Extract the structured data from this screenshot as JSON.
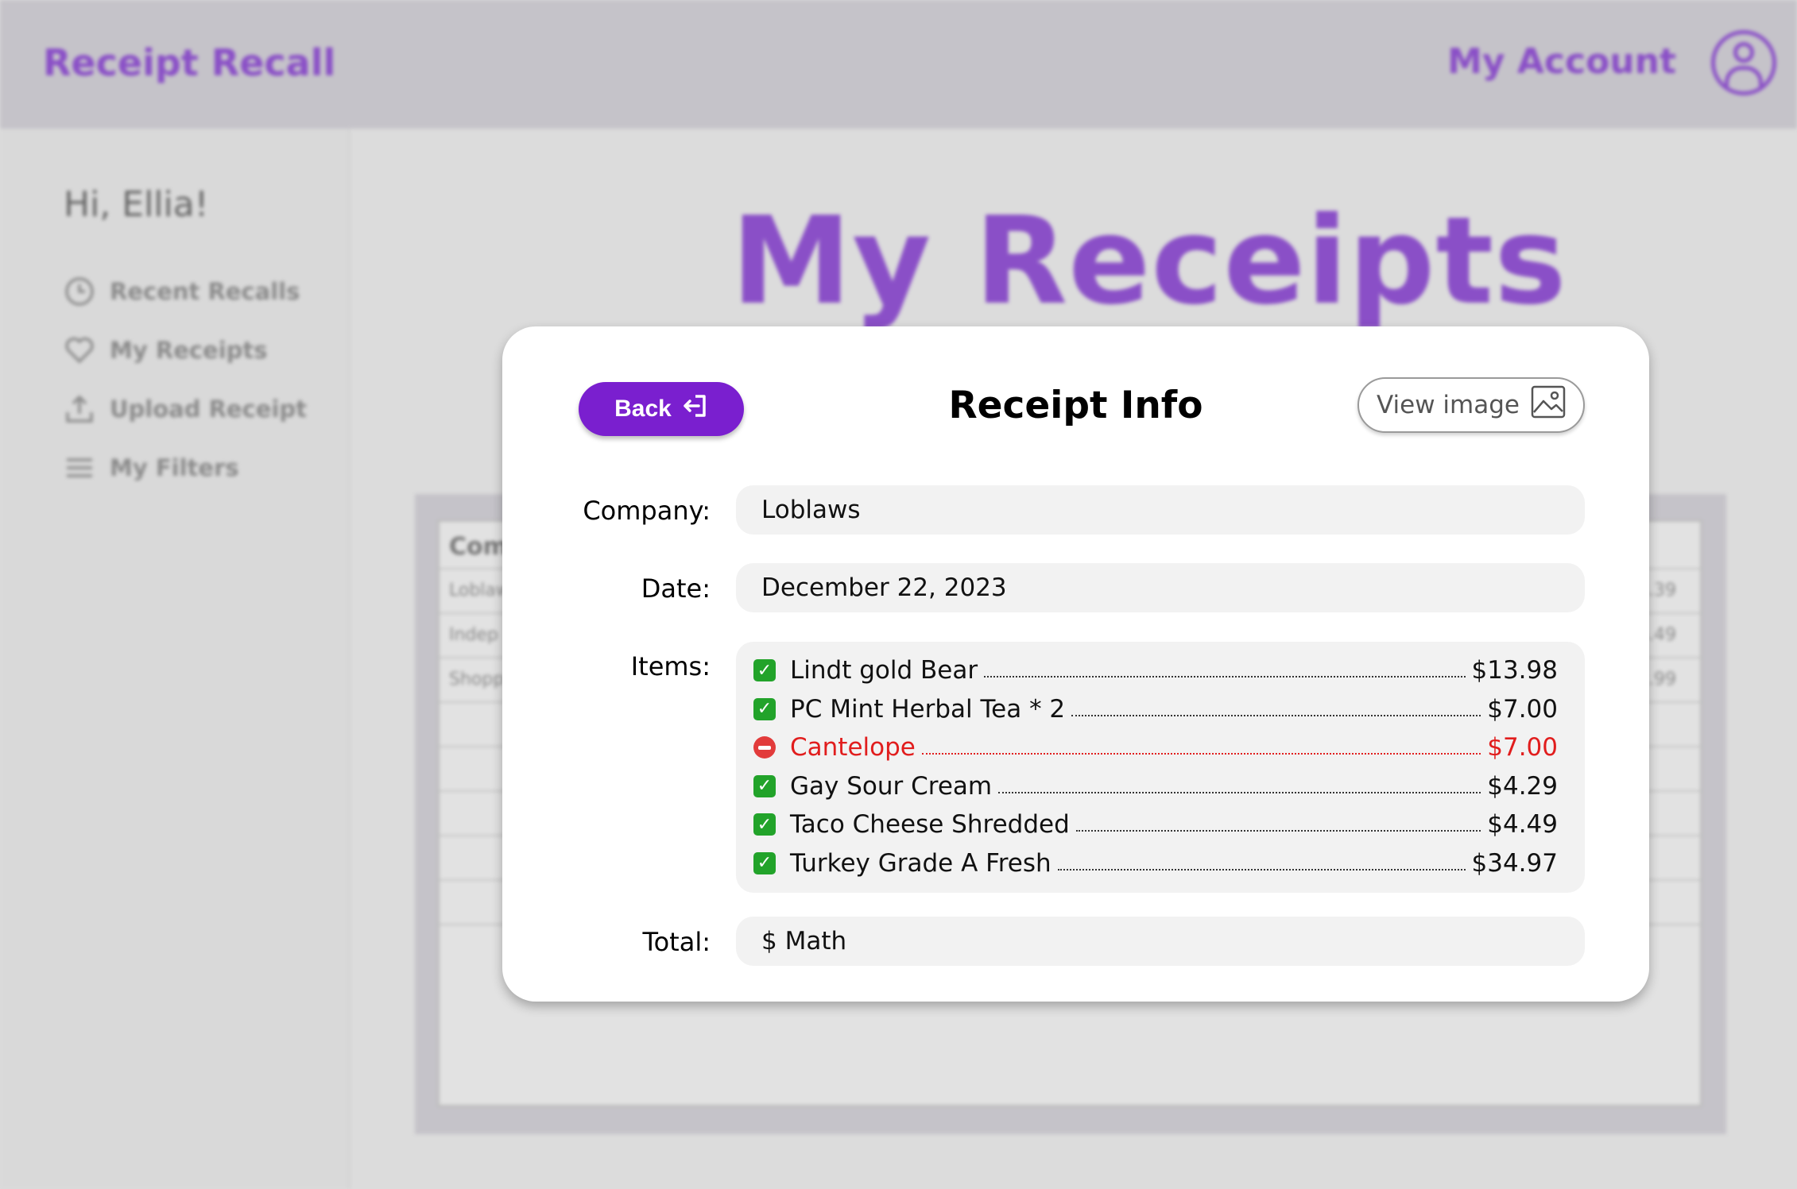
{
  "app": {
    "brand": "Receipt Recall",
    "account_label": "My Account"
  },
  "sidebar": {
    "greeting": "Hi, Ellia!",
    "items": [
      {
        "label": "Recent Recalls",
        "icon": "clock-icon"
      },
      {
        "label": "My Receipts",
        "icon": "heart-icon"
      },
      {
        "label": "Upload Receipt",
        "icon": "upload-icon"
      },
      {
        "label": "My Filters",
        "icon": "menu-icon"
      }
    ]
  },
  "main": {
    "title": "My Receipts",
    "table": {
      "header": "Com",
      "rows": [
        {
          "company": "Loblaw",
          "amount": "3.39"
        },
        {
          "company": "Indep",
          "amount": "6.49"
        },
        {
          "company": "Shopp",
          "amount": "2.99"
        }
      ]
    }
  },
  "modal": {
    "title": "Receipt Info",
    "back_label": "Back",
    "view_image_label": "View image",
    "company_label": "Company:",
    "company_value": "Loblaws",
    "date_label": "Date:",
    "date_value": "December 22, 2023",
    "items_label": "Items:",
    "items": [
      {
        "name": "Lindt gold Bear",
        "price": "$13.98",
        "status": "checked"
      },
      {
        "name": "PC Mint Herbal Tea * 2",
        "price": "$7.00",
        "status": "checked"
      },
      {
        "name": "Cantelope",
        "price": "$7.00",
        "status": "removed"
      },
      {
        "name": "Gay Sour Cream",
        "price": "$4.29",
        "status": "checked"
      },
      {
        "name": "Taco Cheese Shredded",
        "price": "$4.49",
        "status": "checked"
      },
      {
        "name": "Turkey Grade A Fresh",
        "price": "$34.97",
        "status": "checked"
      }
    ],
    "total_label": "Total:",
    "total_value": "$ Math"
  },
  "colors": {
    "accent": "#7a1fcf",
    "brand_purple": "#8a4fc7",
    "removed": "#e11d1d",
    "check_green": "#22a32a"
  }
}
